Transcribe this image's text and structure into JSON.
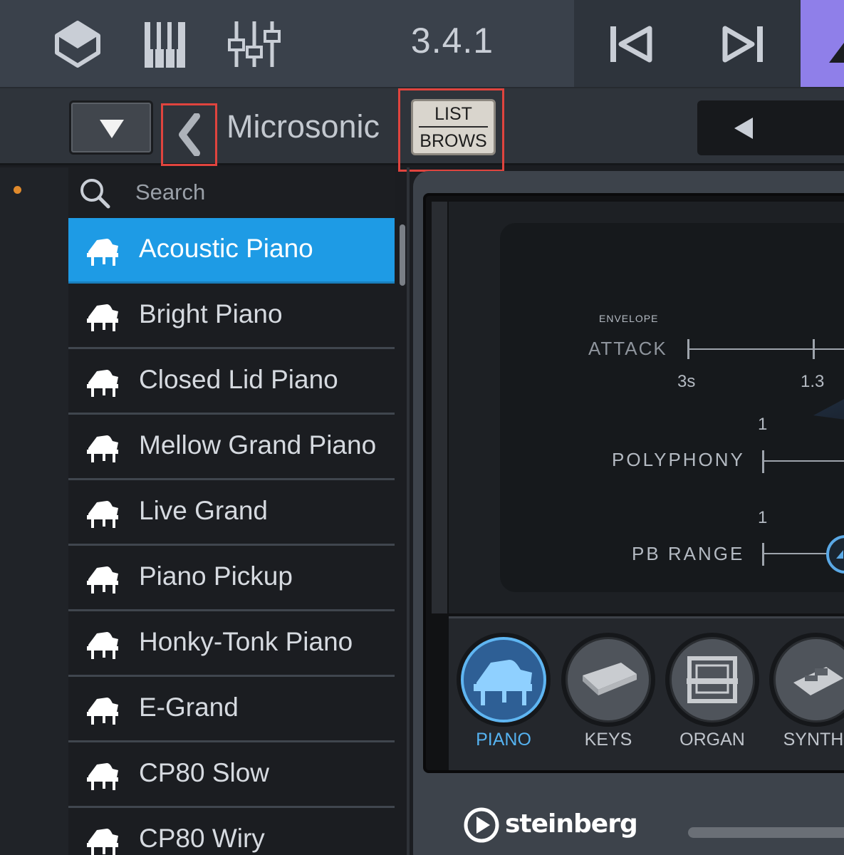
{
  "toolbar": {
    "icons": [
      "cube-icon",
      "piano-keys-icon",
      "mixer-faders-icon",
      "skip-back-icon",
      "skip-forward-icon",
      "metronome-icon"
    ],
    "version": "3.4.1"
  },
  "subbar": {
    "library_title": "Microsonic",
    "list_browse_top": "LIST",
    "list_browse_bottom": "BROWS"
  },
  "search": {
    "placeholder": "Search"
  },
  "presets": [
    {
      "label": "Acoustic Piano",
      "selected": true
    },
    {
      "label": "Bright Piano"
    },
    {
      "label": "Closed Lid Piano"
    },
    {
      "label": "Mellow Grand Piano"
    },
    {
      "label": "Live Grand"
    },
    {
      "label": "Piano Pickup"
    },
    {
      "label": "Honky-Tonk Piano"
    },
    {
      "label": "E-Grand"
    },
    {
      "label": "CP80 Slow"
    },
    {
      "label": "CP80 Wiry"
    }
  ],
  "display": {
    "envelope_label": "ENVELOPE",
    "attack_label": "ATTACK",
    "attack_tick_1": "3s",
    "attack_tick_2": "1.3",
    "polyphony_value": "1",
    "polyphony_label": "POLYPHONY",
    "pb_range_value": "1",
    "pb_range_label": "PB RANGE"
  },
  "instrument_tabs": [
    {
      "label": "PIANO",
      "active": true
    },
    {
      "label": "KEYS"
    },
    {
      "label": "ORGAN"
    },
    {
      "label": "SYNTH"
    }
  ],
  "brand": "steinberg",
  "colors": {
    "selected_row": "#1e9be5",
    "accent_purple": "#8f7fe9",
    "highlight_red": "#e0443e",
    "active_tab_blue": "#55b2f0",
    "status_dot": "#e08a2c"
  }
}
